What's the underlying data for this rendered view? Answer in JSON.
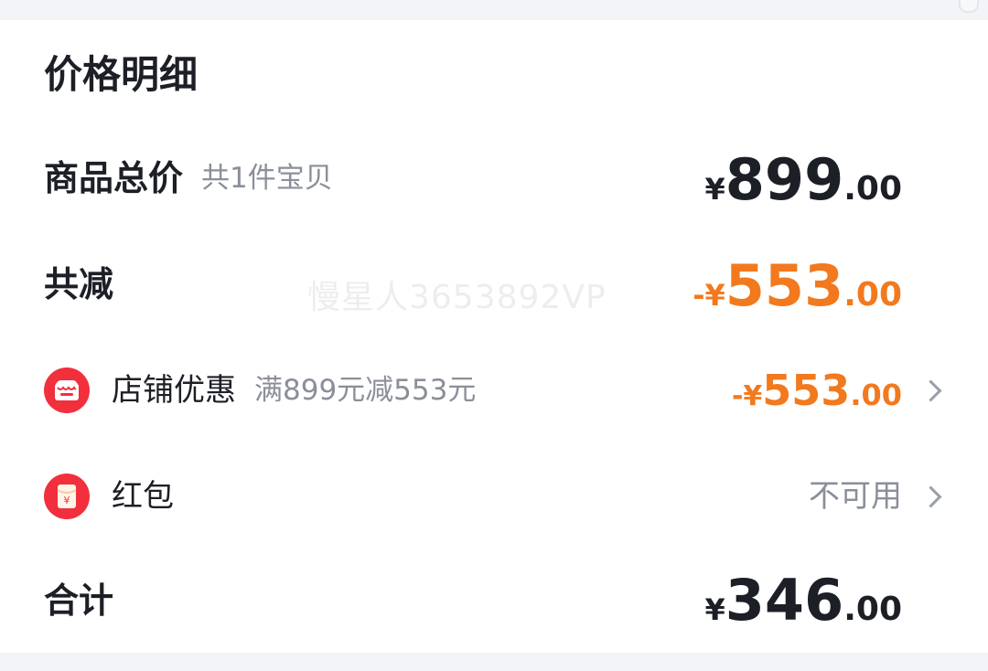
{
  "title": "价格明细",
  "goods_total": {
    "label": "商品总价",
    "sub": "共1件宝贝",
    "currency": "¥",
    "integer": "899",
    "decimal": ".00"
  },
  "total_reduction": {
    "label": "共减",
    "prefix": "-¥",
    "integer": "553",
    "decimal": ".00",
    "color": "#f2791e"
  },
  "store_discount": {
    "label": "店铺优惠",
    "sub": "满899元减553元",
    "prefix": "-¥",
    "integer": "553",
    "decimal": ".00",
    "icon": "store-icon"
  },
  "red_packet": {
    "label": "红包",
    "status": "不可用",
    "icon": "red-envelope-icon"
  },
  "grand_total": {
    "label": "合计",
    "currency": "¥",
    "integer": "346",
    "decimal": ".00"
  },
  "watermark": "慢星人3653892VP",
  "colors": {
    "accent_orange": "#f2791e",
    "icon_red": "#f22f3c",
    "text_dark": "#1c1f26",
    "text_gray": "#8a8f99"
  }
}
